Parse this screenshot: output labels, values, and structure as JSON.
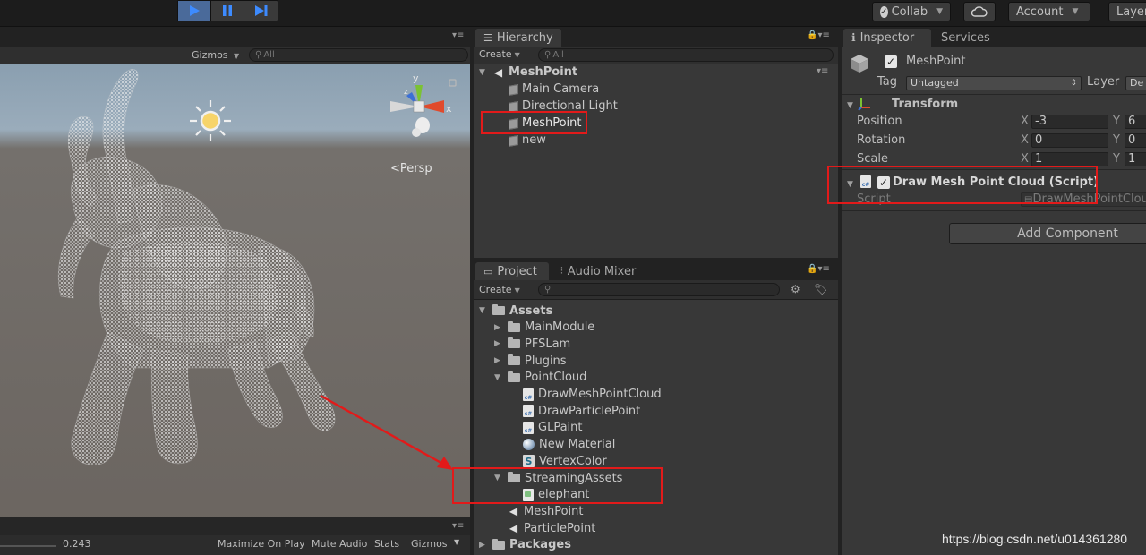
{
  "toolbar": {
    "collab_label": "Collab",
    "account_label": "Account",
    "layers_label": "Layer"
  },
  "scene": {
    "gizmos_label": "Gizmos",
    "search_placeholder": "All",
    "persp_label": "Persp",
    "axis_x": "x",
    "axis_y": "y",
    "axis_z": "z",
    "bottom": {
      "value": "0.243",
      "maximize_label": "Maximize On Play",
      "mute_label": "Mute Audio",
      "stats_label": "Stats",
      "gizmos_label": "Gizmos"
    }
  },
  "hierarchy": {
    "tab_label": "Hierarchy",
    "create_label": "Create",
    "search_placeholder": "All",
    "scene_name": "MeshPoint",
    "items": [
      {
        "label": "Main Camera"
      },
      {
        "label": "Directional Light"
      },
      {
        "label": "MeshPoint"
      },
      {
        "label": "new"
      }
    ]
  },
  "project": {
    "tab_label": "Project",
    "mixer_tab_label": "Audio Mixer",
    "create_label": "Create",
    "tree": [
      {
        "label": "Assets",
        "depth": 0,
        "kind": "folder",
        "bold": true
      },
      {
        "label": "MainModule",
        "depth": 1,
        "kind": "folder"
      },
      {
        "label": "PFSLam",
        "depth": 1,
        "kind": "folder"
      },
      {
        "label": "Plugins",
        "depth": 1,
        "kind": "folder"
      },
      {
        "label": "PointCloud",
        "depth": 1,
        "kind": "folder"
      },
      {
        "label": "DrawMeshPointCloud",
        "depth": 2,
        "kind": "cs"
      },
      {
        "label": "DrawParticlePoint",
        "depth": 2,
        "kind": "cs"
      },
      {
        "label": "GLPaint",
        "depth": 2,
        "kind": "cs"
      },
      {
        "label": "New Material",
        "depth": 2,
        "kind": "material"
      },
      {
        "label": "VertexColor",
        "depth": 2,
        "kind": "shader"
      },
      {
        "label": "StreamingAssets",
        "depth": 1,
        "kind": "folder"
      },
      {
        "label": "elephant",
        "depth": 2,
        "kind": "text"
      },
      {
        "label": "MeshPoint",
        "depth": 1,
        "kind": "scene"
      },
      {
        "label": "ParticlePoint",
        "depth": 1,
        "kind": "scene"
      },
      {
        "label": "Packages",
        "depth": 0,
        "kind": "folder",
        "bold": true
      }
    ]
  },
  "inspector": {
    "tab_label": "Inspector",
    "services_tab_label": "Services",
    "object_name": "MeshPoint",
    "tag_label": "Tag",
    "tag_value": "Untagged",
    "layer_label": "Layer",
    "layer_value": "De",
    "transform_label": "Transform",
    "position_label": "Position",
    "position_x": "-3",
    "position_y": "6",
    "rotation_label": "Rotation",
    "rotation_x": "0",
    "rotation_y": "0",
    "scale_label": "Scale",
    "scale_x": "1",
    "scale_y": "1",
    "x_letter": "X",
    "y_letter": "Y",
    "component_label": "Draw Mesh Point Cloud (Script)",
    "script_label": "Script",
    "script_value": "DrawMeshPointClou",
    "add_component_label": "Add Component"
  },
  "watermark": "https://blog.csdn.net/u014361280",
  "colors": {
    "highlight": "#e21a1a",
    "play_active": "#4a6a9a",
    "play_icon": "#3d8bff"
  }
}
